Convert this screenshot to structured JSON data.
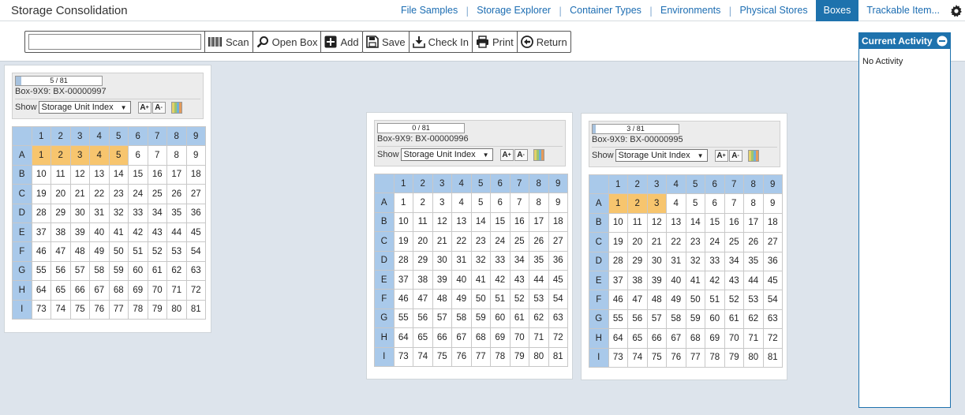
{
  "app": {
    "title": "Storage Consolidation",
    "nav": [
      "File Samples",
      "Storage Explorer",
      "Container Types",
      "Environments",
      "Physical Stores",
      "Boxes",
      "Trackable Item..."
    ],
    "active_nav": "Boxes"
  },
  "toolbar": {
    "scan_value": "",
    "scan_label": "Scan",
    "open_label": "Open Box",
    "add_label": "Add",
    "save_label": "Save",
    "checkin_label": "Check In",
    "print_label": "Print",
    "return_label": "Return"
  },
  "activity": {
    "title": "Current Activity",
    "empty_text": "No Activity"
  },
  "grid_rows": [
    "A",
    "B",
    "C",
    "D",
    "E",
    "F",
    "G",
    "H",
    "I"
  ],
  "grid_cols": [
    "1",
    "2",
    "3",
    "4",
    "5",
    "6",
    "7",
    "8",
    "9"
  ],
  "colors": {
    "occupied": "#f7c56e",
    "header": "#a9c9ea",
    "accent": "#1e72ad",
    "colorbar": [
      "#e4d06a",
      "#9fc56b",
      "#6fb0d9",
      "#e49a5a"
    ]
  },
  "boxes": [
    {
      "progress_text": "5 / 81",
      "progress_fraction": 0.0617,
      "label": "Box-9X9: BX-00000997",
      "show_label": "Show",
      "show_value": "Storage Unit Index",
      "occupied_count": 5
    },
    {
      "progress_text": "0 / 81",
      "progress_fraction": 0,
      "label": "Box-9X9: BX-00000996",
      "show_label": "Show",
      "show_value": "Storage Unit Index",
      "occupied_count": 0
    },
    {
      "progress_text": "3 / 81",
      "progress_fraction": 0.037,
      "label": "Box-9X9: BX-00000995",
      "show_label": "Show",
      "show_value": "Storage Unit Index",
      "occupied_count": 3
    }
  ]
}
